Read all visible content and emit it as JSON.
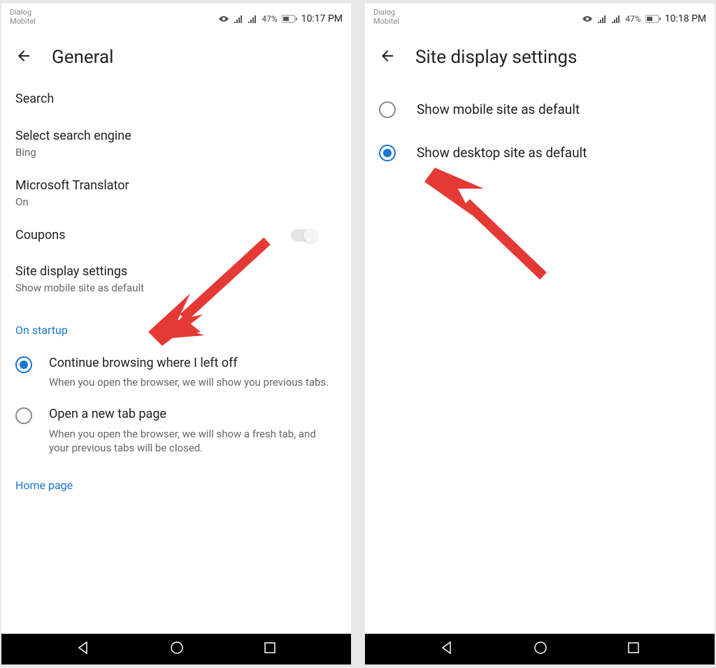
{
  "left": {
    "status": {
      "carrier1": "Dialog",
      "carrier2": "Mobitel",
      "battery": "47%",
      "time": "10:17 PM"
    },
    "header": {
      "title": "General"
    },
    "search_label": "Search",
    "select_engine": {
      "title": "Select search engine",
      "value": "Bing"
    },
    "translator": {
      "title": "Microsoft Translator",
      "value": "On"
    },
    "coupons": {
      "title": "Coupons"
    },
    "site_display": {
      "title": "Site display settings",
      "value": "Show mobile site as default"
    },
    "startup_header": "On startup",
    "startup": [
      {
        "title": "Continue browsing where I left off",
        "desc": "When you open the browser, we will show you previous tabs.",
        "checked": true
      },
      {
        "title": "Open a new tab page",
        "desc": "When you open the browser, we will show a fresh tab, and your previous tabs will be closed.",
        "checked": false
      }
    ],
    "homepage": "Home page"
  },
  "right": {
    "status": {
      "carrier1": "Dialog",
      "carrier2": "Mobitel",
      "battery": "47%",
      "time": "10:18 PM"
    },
    "header": {
      "title": "Site display settings"
    },
    "options": [
      {
        "label": "Show mobile site as default",
        "checked": false
      },
      {
        "label": "Show desktop site as default",
        "checked": true
      }
    ]
  }
}
